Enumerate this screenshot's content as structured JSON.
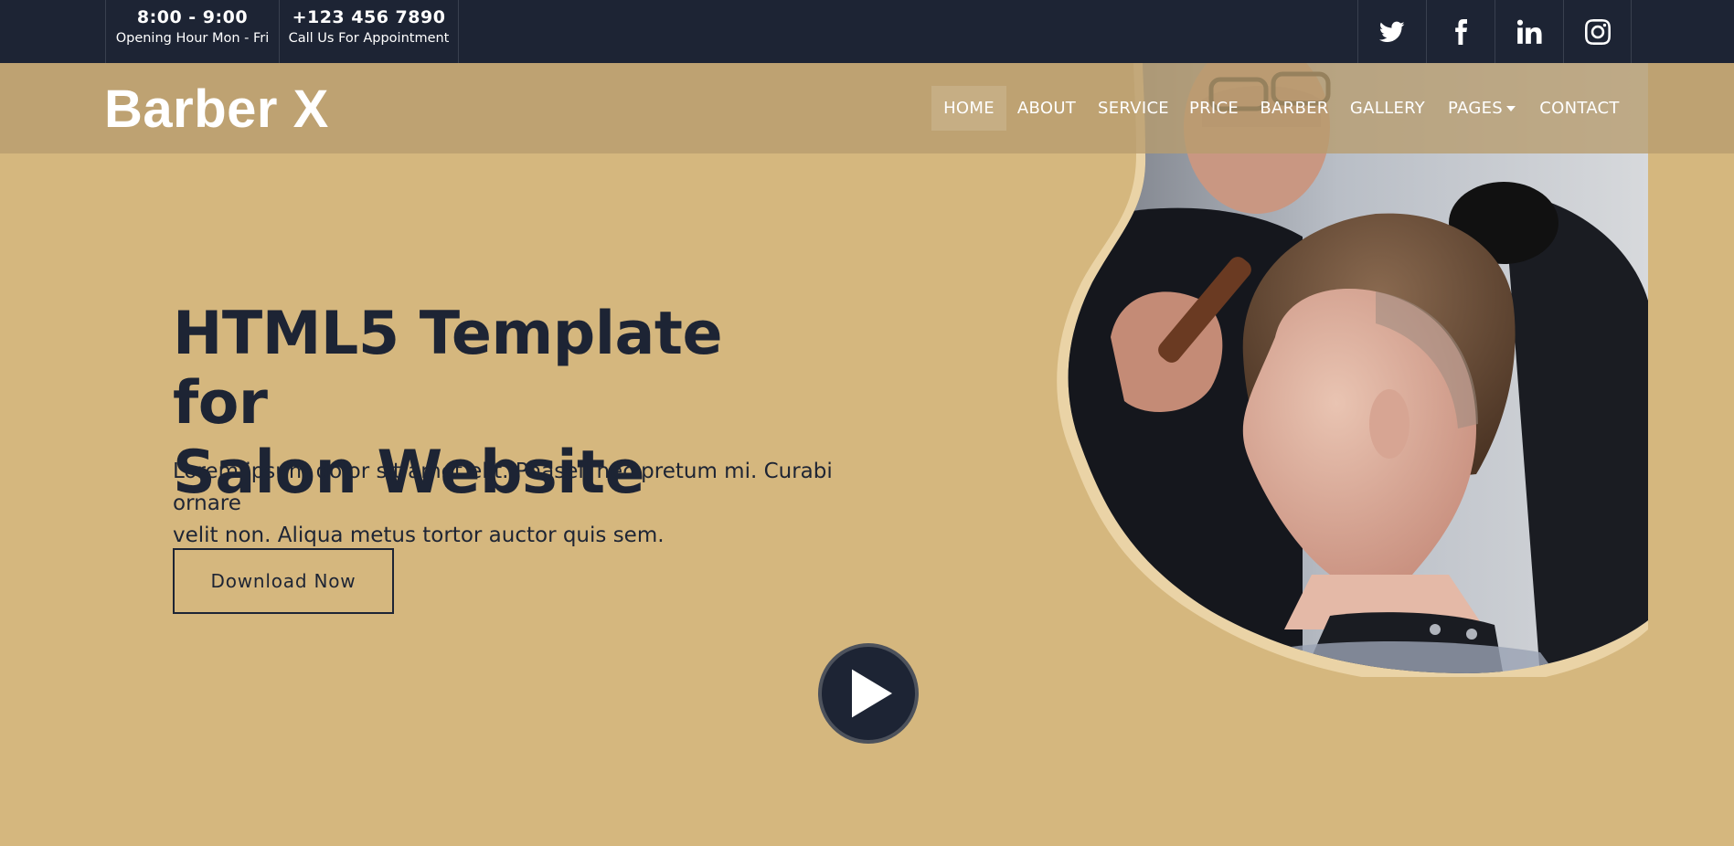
{
  "topbar": {
    "hours_time": "8:00 - 9:00",
    "hours_label": "Opening Hour Mon - Fri",
    "phone_number": "+123 456 7890",
    "phone_label": "Call Us For Appointment",
    "social": [
      "twitter-icon",
      "facebook-icon",
      "linkedin-icon",
      "instagram-icon"
    ]
  },
  "brand": {
    "name": "Barber ",
    "mark": "X"
  },
  "nav": {
    "items": [
      "HOME",
      "ABOUT",
      "SERVICE",
      "PRICE",
      "BARBER",
      "GALLERY",
      "PAGES",
      "CONTACT"
    ],
    "active": "HOME"
  },
  "hero": {
    "title_line1": "HTML5 Template for",
    "title_line2": "Salon Website",
    "text_line1": "Lorem ipsum dolor sit amet elit. Phasell nec pretum mi. Curabi ornare",
    "text_line2": "velit non. Aliqua metus tortor auctor quis sem.",
    "button_label": "Download Now"
  },
  "colors": {
    "dark": "#1d2434",
    "gold": "#d5b77e",
    "navbar": "#c1a577",
    "white": "#ffffff"
  }
}
